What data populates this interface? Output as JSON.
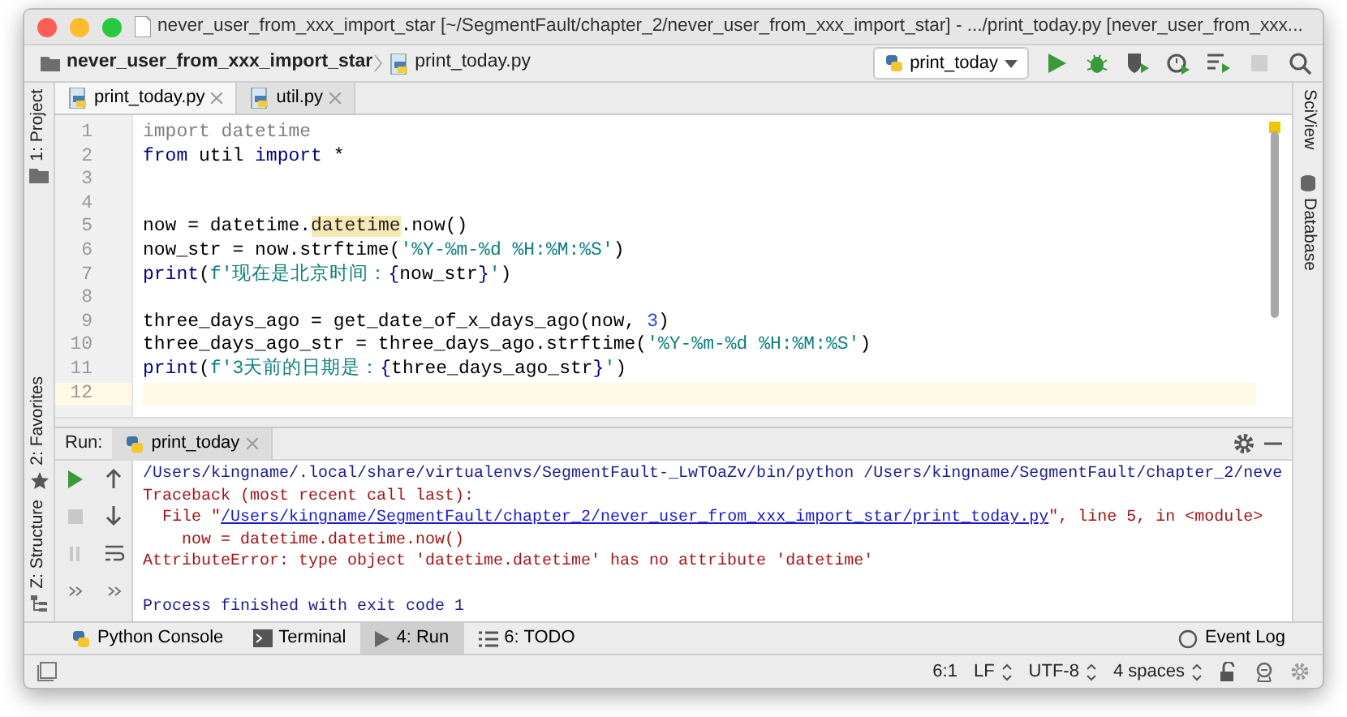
{
  "window": {
    "title": "never_user_from_xxx_import_star [~/SegmentFault/chapter_2/never_user_from_xxx_import_star] - .../print_today.py [never_user_from_xxx..."
  },
  "breadcrumb": [
    {
      "label": "never_user_from_xxx_import_star",
      "kind": "folder"
    },
    {
      "label": "print_today.py",
      "kind": "file"
    }
  ],
  "run_config": {
    "label": "print_today"
  },
  "toolbar": [
    {
      "kind": "run",
      "disabled": false
    },
    {
      "kind": "debug",
      "disabled": false
    },
    {
      "kind": "coverage",
      "disabled": false
    },
    {
      "kind": "profile",
      "disabled": false
    },
    {
      "kind": "concurrency",
      "disabled": false
    },
    {
      "kind": "stop",
      "disabled": true
    },
    {
      "kind": "search",
      "disabled": false
    }
  ],
  "left_stripe": [
    {
      "label": "1: Project",
      "kind": "folder"
    },
    {
      "label": "2: Favorites",
      "kind": "star"
    },
    {
      "label": "Z: Structure",
      "kind": "structure"
    }
  ],
  "right_stripe": [
    {
      "label": "SciView",
      "kind": "none"
    },
    {
      "label": "Database",
      "kind": "database"
    }
  ],
  "editor_tabs": [
    {
      "label": "print_today.py",
      "selected": true
    },
    {
      "label": "util.py",
      "selected": false
    }
  ],
  "code_lines": [
    {
      "number": "1",
      "current": false,
      "tokens": [
        {
          "text": "import datetime",
          "kind": "unused"
        }
      ]
    },
    {
      "number": "2",
      "current": false,
      "tokens": [
        {
          "text": "from",
          "kind": "keyword"
        },
        {
          "text": " util ",
          "kind": "plain"
        },
        {
          "text": "import",
          "kind": "keyword"
        },
        {
          "text": " *",
          "kind": "plain"
        }
      ]
    },
    {
      "number": "3",
      "current": false
    },
    {
      "number": "4",
      "current": false
    },
    {
      "number": "5",
      "current": false,
      "tokens": [
        {
          "text": "now = datetime.",
          "kind": "plain"
        },
        {
          "text": "datetime",
          "kind": "highlight"
        },
        {
          "text": ".now()",
          "kind": "plain"
        }
      ]
    },
    {
      "number": "6",
      "current": false,
      "tokens": [
        {
          "text": "now_str = now.strftime(",
          "kind": "plain"
        },
        {
          "text": "'%Y-%m-%d %H:%M:%S'",
          "kind": "string"
        },
        {
          "text": ")",
          "kind": "plain"
        }
      ]
    },
    {
      "number": "7",
      "current": false,
      "tokens": [
        {
          "text": "print",
          "kind": "keyword"
        },
        {
          "text": "(",
          "kind": "plain"
        },
        {
          "text": "f'现在是北京时间：",
          "kind": "string"
        },
        {
          "text": "{",
          "kind": "keyword"
        },
        {
          "text": "now_str",
          "kind": "plain"
        },
        {
          "text": "}",
          "kind": "keyword"
        },
        {
          "text": "'",
          "kind": "string"
        },
        {
          "text": ")",
          "kind": "plain"
        }
      ]
    },
    {
      "number": "8",
      "current": false
    },
    {
      "number": "9",
      "current": false,
      "tokens": [
        {
          "text": "three_days_ago = get_date_of_x_days_ago(now, ",
          "kind": "plain"
        },
        {
          "text": "3",
          "kind": "number"
        },
        {
          "text": ")",
          "kind": "plain"
        }
      ]
    },
    {
      "number": "10",
      "current": false,
      "tokens": [
        {
          "text": "three_days_ago_str = three_days_ago.strftime(",
          "kind": "plain"
        },
        {
          "text": "'%Y-%m-%d %H:%M:%S'",
          "kind": "string"
        },
        {
          "text": ")",
          "kind": "plain"
        }
      ]
    },
    {
      "number": "11",
      "current": false,
      "tokens": [
        {
          "text": "print",
          "kind": "keyword"
        },
        {
          "text": "(",
          "kind": "plain"
        },
        {
          "text": "f'3天前的日期是：",
          "kind": "string"
        },
        {
          "text": "{",
          "kind": "keyword"
        },
        {
          "text": "three_days_ago_str",
          "kind": "plain"
        },
        {
          "text": "}",
          "kind": "keyword"
        },
        {
          "text": "'",
          "kind": "string"
        },
        {
          "text": ")",
          "kind": "plain"
        }
      ]
    },
    {
      "number": "12",
      "current": true
    }
  ],
  "run_panel": {
    "label": "Run:",
    "tab": "print_today",
    "output": [
      {
        "segments": [
          {
            "text": "/Users/kingname/.local/share/virtualenvs/SegmentFault-_LwTOaZv/bin/python /Users/kingname/SegmentFault/chapter_2/neve",
            "kind": "info"
          }
        ]
      },
      {
        "segments": [
          {
            "text": "Traceback (most recent call last):",
            "kind": "error"
          }
        ]
      },
      {
        "segments": [
          {
            "text": "  File \"",
            "kind": "error"
          },
          {
            "text": "/Users/kingname/SegmentFault/chapter_2/never_user_from_xxx_import_star/print_today.py",
            "kind": "link"
          },
          {
            "text": "\", line 5, in <module>",
            "kind": "error"
          }
        ]
      },
      {
        "segments": [
          {
            "text": "    now = datetime.datetime.now()",
            "kind": "error"
          }
        ]
      },
      {
        "segments": [
          {
            "text": "AttributeError: type object 'datetime.datetime' has no attribute 'datetime'",
            "kind": "error"
          }
        ]
      },
      {
        "blank_before": true,
        "segments": [
          {
            "text": "Process finished with exit code 1",
            "kind": "info"
          }
        ]
      }
    ]
  },
  "tool_tabs": [
    {
      "label": "Python Console",
      "kind": "python",
      "selected": false
    },
    {
      "label": "Terminal",
      "kind": "terminal",
      "selected": false
    },
    {
      "label": "4: Run",
      "kind": "run",
      "selected": true
    },
    {
      "label": "6: TODO",
      "kind": "todo",
      "selected": false
    }
  ],
  "event_log": {
    "label": "Event Log"
  },
  "status_bar": {
    "position": "6:1",
    "line_separator": "LF",
    "encoding": "UTF-8",
    "indent": "4 spaces"
  }
}
